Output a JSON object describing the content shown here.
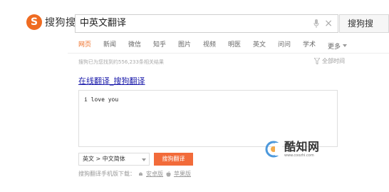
{
  "logo": {
    "mark": "S",
    "text": "搜狗搜索"
  },
  "search": {
    "query": "中英文翻译",
    "button_label": "搜狗搜"
  },
  "tabs": [
    {
      "label": "网页",
      "active": true
    },
    {
      "label": "新闻"
    },
    {
      "label": "微信"
    },
    {
      "label": "知乎"
    },
    {
      "label": "图片"
    },
    {
      "label": "视频"
    },
    {
      "label": "明医"
    },
    {
      "label": "英文"
    },
    {
      "label": "问问"
    },
    {
      "label": "学术"
    },
    {
      "label": "更多"
    }
  ],
  "result_count": "搜狗已为您找到约556,233条相关结果",
  "time_filter": "全部时间",
  "result_title": "在线翻译_搜狗翻译",
  "translator": {
    "input_text": "i love you",
    "language_pair": "英文 > 中文简体",
    "translate_button": "搜狗翻译"
  },
  "download": {
    "prefix": "搜狗翻译手机版下载：",
    "android": "安卓版",
    "apple": "苹果版"
  },
  "watermark": {
    "text": "酷知网",
    "sub": "www.coozhi.com"
  },
  "colors": {
    "accent": "#ef6b21",
    "button": "#f26b3a",
    "link": "#1a1aaa"
  }
}
